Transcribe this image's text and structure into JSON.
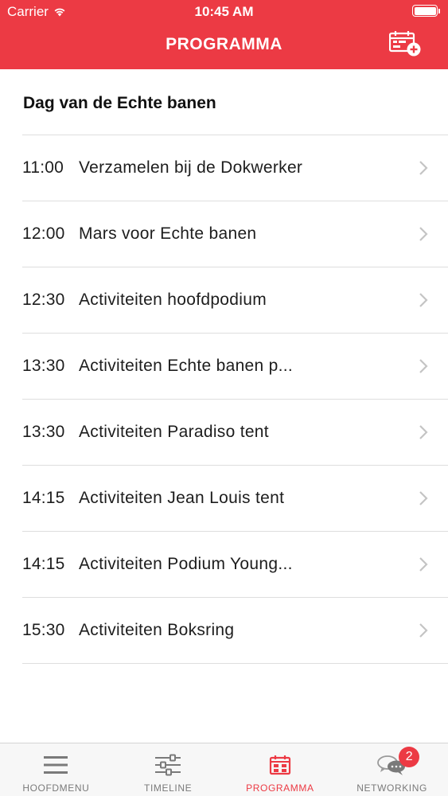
{
  "status_bar": {
    "carrier": "Carrier",
    "time": "10:45 AM"
  },
  "nav": {
    "title": "PROGRAMMA",
    "action_icon": "add-calendar-icon"
  },
  "section": {
    "title": "Dag van de Echte banen"
  },
  "items": [
    {
      "time": "11:00",
      "title": "Verzamelen bij de Dokwerker"
    },
    {
      "time": "12:00",
      "title": "Mars voor Echte banen"
    },
    {
      "time": "12:30",
      "title": "Activiteiten hoofdpodium"
    },
    {
      "time": "13:30",
      "title": "Activiteiten Echte banen p..."
    },
    {
      "time": "13:30",
      "title": "Activiteiten Paradiso tent"
    },
    {
      "time": "14:15",
      "title": "Activiteiten Jean Louis tent"
    },
    {
      "time": "14:15",
      "title": "Activiteiten Podium Young..."
    },
    {
      "time": "15:30",
      "title": "Activiteiten Boksring"
    }
  ],
  "tabbar": {
    "tabs": [
      {
        "label": "HOOFDMENU",
        "icon": "hamburger-menu-icon",
        "active": false
      },
      {
        "label": "TIMELINE",
        "icon": "sliders-icon",
        "active": false
      },
      {
        "label": "PROGRAMMA",
        "icon": "calendar-grid-icon",
        "active": true
      },
      {
        "label": "NETWORKING",
        "icon": "chat-bubbles-icon",
        "active": false,
        "badge": "2"
      }
    ]
  },
  "colors": {
    "accent": "#ec3a44",
    "inactive_tab": "#7a7a7a",
    "separator": "#dedede"
  }
}
